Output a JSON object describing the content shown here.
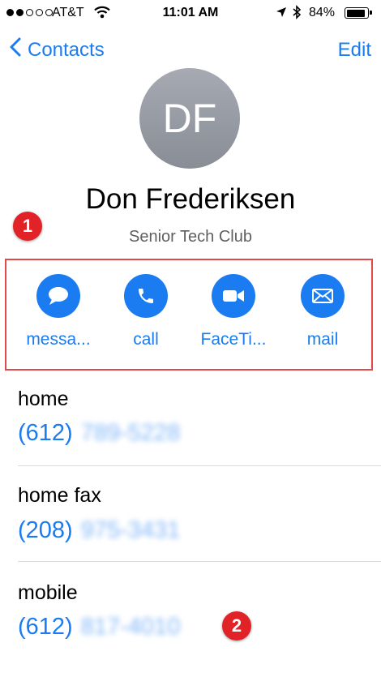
{
  "status_bar": {
    "carrier": "AT&T",
    "time": "11:01 AM",
    "battery": "84%",
    "signal_bars": 2,
    "battery_level": 0.84
  },
  "nav": {
    "back_label": "Contacts",
    "edit_label": "Edit"
  },
  "contact": {
    "initials": "DF",
    "name": "Don Frederiksen",
    "company": "Senior Tech Club"
  },
  "actions": [
    {
      "label": "messa...",
      "icon": "message-bubble-icon"
    },
    {
      "label": "call",
      "icon": "phone-icon"
    },
    {
      "label": "FaceTi...",
      "icon": "video-camera-icon"
    },
    {
      "label": "mail",
      "icon": "envelope-icon"
    }
  ],
  "fields": [
    {
      "label": "home",
      "area_code": "(612)",
      "number_blurred": "789-5228"
    },
    {
      "label": "home fax",
      "area_code": "(208)",
      "number_blurred": "975-3431"
    },
    {
      "label": "mobile",
      "area_code": "(612)",
      "number_blurred": "817-4010"
    }
  ],
  "annotations": {
    "badge_1": "1",
    "badge_2": "2"
  },
  "colors": {
    "accent": "#1a7cf0",
    "annotation_red": "#e12227",
    "highlight_border": "#e44949"
  }
}
